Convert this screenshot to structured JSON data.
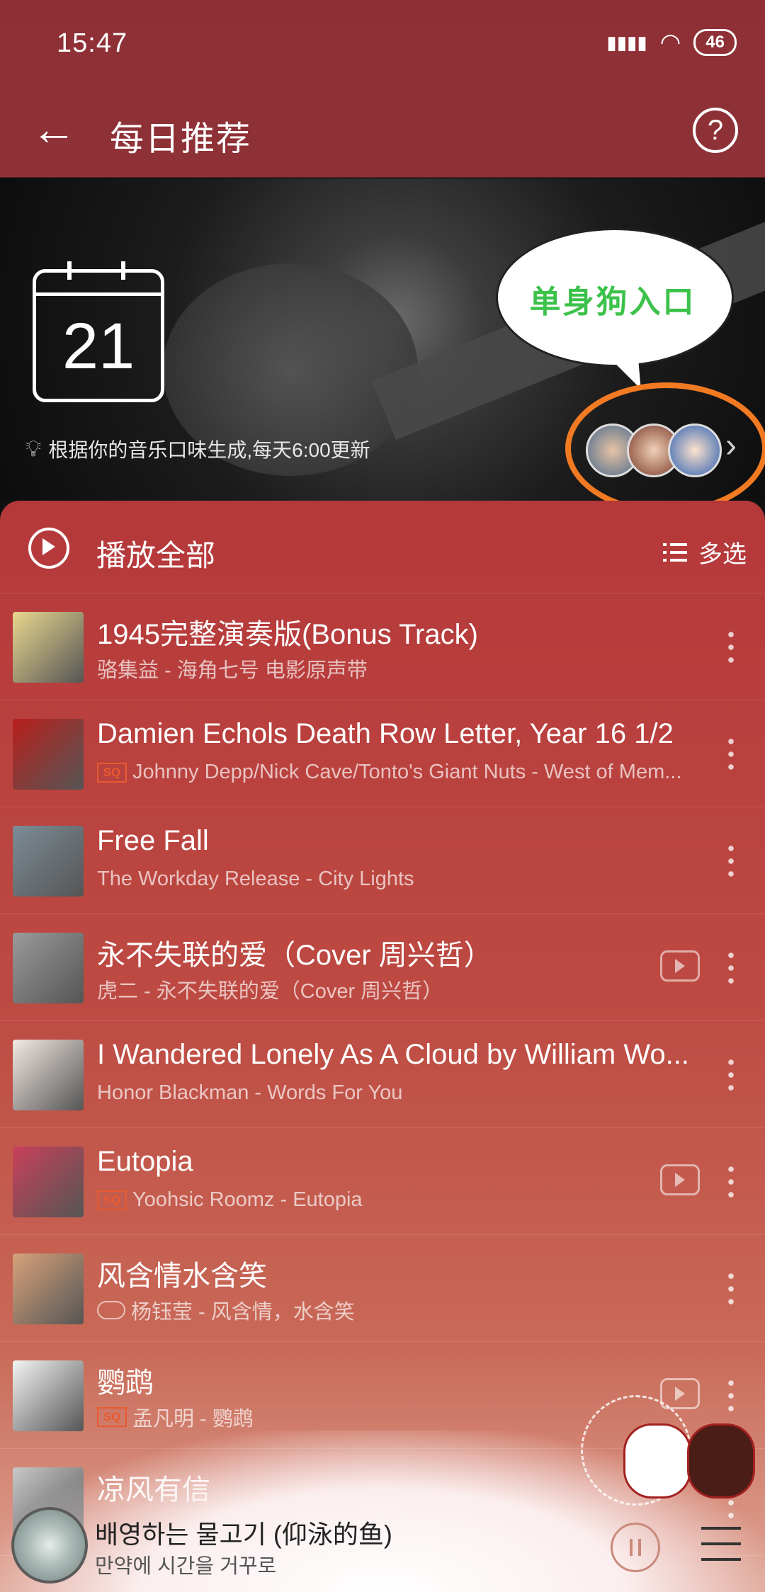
{
  "status_bar": {
    "time": "15:47",
    "battery": "46"
  },
  "header": {
    "back_icon": "←",
    "title": "每日推荐",
    "help_icon": "?"
  },
  "banner": {
    "calendar_day": "21",
    "note": "根据你的音乐口味生成,每天6:00更新",
    "bubble_text": "单身狗入口",
    "chevron": "›"
  },
  "toolbar": {
    "play_all_label": "播放全部",
    "multi_select_label": "多选"
  },
  "songs": [
    {
      "title": "1945完整演奏版(Bonus Track)",
      "subtitle": "骆集益 - 海角七号 电影原声带",
      "badge": "",
      "mv": false,
      "cover_color": "#e9d78e"
    },
    {
      "title": "Damien Echols Death Row Letter, Year 16 1/2",
      "subtitle": "Johnny Depp/Nick Cave/Tonto's Giant Nuts - West of Mem...",
      "badge": "SQ",
      "mv": false,
      "cover_color": "#b8201c"
    },
    {
      "title": "Free Fall",
      "subtitle": "The Workday Release - City Lights",
      "badge": "",
      "mv": false,
      "cover_color": "#7d8c96"
    },
    {
      "title": "永不失联的爱（Cover 周兴哲）",
      "subtitle": "虎二 - 永不失联的爱（Cover 周兴哲）",
      "badge": "",
      "mv": true,
      "cover_color": "#9a9a9a"
    },
    {
      "title": "I Wandered Lonely As A Cloud by William Wo...",
      "subtitle": "Honor Blackman - Words For You",
      "badge": "",
      "mv": false,
      "cover_color": "#f2e9e2"
    },
    {
      "title": "Eutopia",
      "subtitle": "Yoohsic Roomz - Eutopia",
      "badge": "SQ",
      "mv": true,
      "cover_color": "#c9405a"
    },
    {
      "title": "风含情水含笑",
      "subtitle": "杨钰莹 - 风含情，水含笑",
      "badge": "cloud",
      "mv": false,
      "cover_color": "#d7a27a"
    },
    {
      "title": "鹦鹉",
      "subtitle": "孟凡明 - 鹦鹉",
      "badge": "SQ",
      "mv": true,
      "cover_color": "#f4f4f4"
    },
    {
      "title": "凉风有信",
      "subtitle": "",
      "badge": "",
      "mv": false,
      "cover_color": "#c8c8c8"
    }
  ],
  "player": {
    "title": "배영하는 물고기 (仰泳的鱼)",
    "subtitle": "만약에 시간을 거꾸로"
  },
  "colors": {
    "accent": "#b5383a",
    "sq_badge": "#e85a30",
    "highlight": "#f27a22",
    "bubble_text": "#3cc24a"
  }
}
